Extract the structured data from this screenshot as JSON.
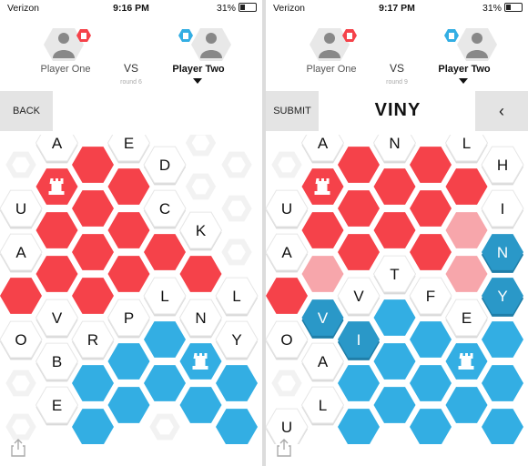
{
  "left": {
    "status": {
      "carrier": "Verizon",
      "time": "9:16 PM",
      "battery": "31%"
    },
    "player_one": "Player One",
    "player_two": "Player Two",
    "vs": "VS",
    "round": "round 6",
    "back_label": "BACK",
    "board": {
      "cols": [
        [
          {
            "s": "g"
          },
          {
            "s": "w",
            "l": "U"
          },
          {
            "s": "w",
            "l": "A"
          },
          {
            "s": "r"
          },
          {
            "s": "w",
            "l": "O"
          },
          {
            "s": "g"
          },
          {
            "s": "g"
          }
        ],
        [
          {
            "s": "w",
            "l": "A"
          },
          {
            "s": "r",
            "b": true
          },
          {
            "s": "r"
          },
          {
            "s": "r"
          },
          {
            "s": "w",
            "l": "V"
          },
          {
            "s": "w",
            "l": "B"
          },
          {
            "s": "w",
            "l": "E"
          }
        ],
        [
          {
            "s": "r"
          },
          {
            "s": "r"
          },
          {
            "s": "r"
          },
          {
            "s": "r"
          },
          {
            "s": "w",
            "l": "R"
          },
          {
            "s": "b"
          },
          {
            "s": "b"
          }
        ],
        [
          {
            "s": "w",
            "l": "E"
          },
          {
            "s": "r"
          },
          {
            "s": "r"
          },
          {
            "s": "r"
          },
          {
            "s": "w",
            "l": "P"
          },
          {
            "s": "b"
          },
          {
            "s": "b"
          }
        ],
        [
          {
            "s": "w",
            "l": "D"
          },
          {
            "s": "w",
            "l": "C"
          },
          {
            "s": "r"
          },
          {
            "s": "w",
            "l": "L"
          },
          {
            "s": "b"
          },
          {
            "s": "b"
          },
          {
            "s": "g"
          }
        ],
        [
          {
            "s": "g"
          },
          {
            "s": "g"
          },
          {
            "s": "w",
            "l": "K"
          },
          {
            "s": "r"
          },
          {
            "s": "w",
            "l": "N"
          },
          {
            "s": "b",
            "b": true
          },
          {
            "s": "b"
          }
        ],
        [
          {
            "s": "g"
          },
          {
            "s": "g"
          },
          {
            "s": "g"
          },
          {
            "s": "w",
            "l": "L"
          },
          {
            "s": "w",
            "l": "Y"
          },
          {
            "s": "b"
          },
          {
            "s": "b"
          }
        ]
      ]
    }
  },
  "right": {
    "status": {
      "carrier": "Verizon",
      "time": "9:17 PM",
      "battery": "31%"
    },
    "player_one": "Player One",
    "player_two": "Player Two",
    "vs": "VS",
    "round": "round 9",
    "submit_label": "SUBMIT",
    "word": "VINY",
    "clear_label": "‹",
    "board": {
      "cols": [
        [
          {
            "s": "g"
          },
          {
            "s": "w",
            "l": "U"
          },
          {
            "s": "w",
            "l": "A"
          },
          {
            "s": "r"
          },
          {
            "s": "w",
            "l": "O"
          },
          {
            "s": "g"
          },
          {
            "s": "w",
            "l": "U"
          }
        ],
        [
          {
            "s": "w",
            "l": "A"
          },
          {
            "s": "r",
            "b": true
          },
          {
            "s": "r"
          },
          {
            "s": "lr"
          },
          {
            "s": "ab",
            "l": "V"
          },
          {
            "s": "w",
            "l": "A"
          },
          {
            "s": "w",
            "l": "L"
          }
        ],
        [
          {
            "s": "r"
          },
          {
            "s": "r"
          },
          {
            "s": "r"
          },
          {
            "s": "w",
            "l": "V"
          },
          {
            "s": "ab",
            "l": "I"
          },
          {
            "s": "b"
          },
          {
            "s": "b"
          }
        ],
        [
          {
            "s": "w",
            "l": "N"
          },
          {
            "s": "r"
          },
          {
            "s": "r"
          },
          {
            "s": "w",
            "l": "T"
          },
          {
            "s": "b"
          },
          {
            "s": "b"
          },
          {
            "s": "b"
          }
        ],
        [
          {
            "s": "r"
          },
          {
            "s": "r"
          },
          {
            "s": "r"
          },
          {
            "s": "w",
            "l": "F"
          },
          {
            "s": "b"
          },
          {
            "s": "b"
          },
          {
            "s": "b"
          }
        ],
        [
          {
            "s": "w",
            "l": "L"
          },
          {
            "s": "r"
          },
          {
            "s": "lr"
          },
          {
            "s": "lr"
          },
          {
            "s": "w",
            "l": "E"
          },
          {
            "s": "b",
            "b": true
          },
          {
            "s": "b"
          }
        ],
        [
          {
            "s": "w",
            "l": "H"
          },
          {
            "s": "w",
            "l": "I"
          },
          {
            "s": "ab",
            "l": "N"
          },
          {
            "s": "ab",
            "l": "Y"
          },
          {
            "s": "b"
          },
          {
            "s": "b"
          },
          {
            "s": "b"
          }
        ]
      ]
    }
  },
  "colors": {
    "red": "#f5424a",
    "light_red": "#f7a6ab",
    "blue": "#33aee3",
    "active_blue": "#2a98c8",
    "tile_white": "#ffffff",
    "tile_empty": "#f2f2f2"
  }
}
